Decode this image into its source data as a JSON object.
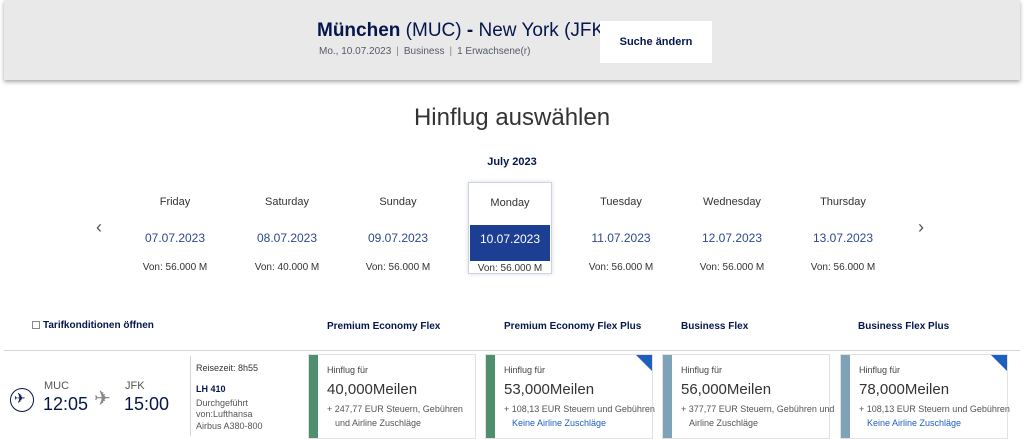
{
  "header": {
    "origin_city": "München",
    "origin_code": "(MUC)",
    "dash": "-",
    "dest_city": "New York",
    "dest_code": "(JFK)",
    "date": "Mo., 10.07.2023",
    "cabin": "Business",
    "pax": "1 Erwachsene(r)",
    "sep": "|",
    "change_label": "Suche ändern"
  },
  "title": "Hinflug auswählen",
  "month": "July 2023",
  "nav": {
    "prev_icon": "chevron-left-icon",
    "next_icon": "chevron-right-icon",
    "prev": "‹",
    "next": "›"
  },
  "days": [
    {
      "weekday": "Friday",
      "date": "07.07.2023",
      "price": "Von: 56.000 M",
      "selected": false
    },
    {
      "weekday": "Saturday",
      "date": "08.07.2023",
      "price": "Von: 40.000 M",
      "selected": false
    },
    {
      "weekday": "Sunday",
      "date": "09.07.2023",
      "price": "Von: 56.000 M",
      "selected": false
    },
    {
      "weekday": "Monday",
      "date": "10.07.2023",
      "price": "Von: 56.000 M",
      "selected": true
    },
    {
      "weekday": "Tuesday",
      "date": "11.07.2023",
      "price": "Von: 56.000 M",
      "selected": false
    },
    {
      "weekday": "Wednesday",
      "date": "12.07.2023",
      "price": "Von: 56.000 M",
      "selected": false
    },
    {
      "weekday": "Thursday",
      "date": "13.07.2023",
      "price": "Von: 56.000 M",
      "selected": false
    }
  ],
  "fare_table": {
    "tarif_link": "Tarifkonditionen öffnen",
    "headers": [
      "Premium Economy Flex",
      "Premium Economy Flex Plus",
      "Business Flex",
      "Business Flex Plus"
    ]
  },
  "flight": {
    "from_code": "MUC",
    "from_time": "12:05",
    "to_code": "JFK",
    "to_time": "15:00",
    "duration": "Reisezeit: 8h55",
    "flight_no": "LH 410",
    "operated1": "Durchgeführt",
    "operated2": "von:Lufthansa",
    "aircraft": "Airbus A380-800"
  },
  "fares": [
    {
      "label": "Hinflug für",
      "miles": "40,000Meilen",
      "tax1": "+ 247,77 EUR Steuern, Gebühren",
      "tax2": "und Airline Zuschläge",
      "bar_color": "#4e8f6e",
      "badge": false,
      "tax2_link": false
    },
    {
      "label": "Hinflug für",
      "miles": "53,000Meilen",
      "tax1": "+ 108,13 EUR Steuern und Gebühren",
      "tax2": "Keine Airline Zuschläge",
      "bar_color": "#4e8f6e",
      "badge": true,
      "tax2_link": true
    },
    {
      "label": "Hinflug für",
      "miles": "56,000Meilen",
      "tax1": "+ 377,77 EUR Steuern, Gebühren und",
      "tax2": "Airline Zuschläge",
      "bar_color": "#7ea3b8",
      "badge": false,
      "tax2_link": false
    },
    {
      "label": "Hinflug für",
      "miles": "78,000Meilen",
      "tax1": "+ 108,13 EUR Steuern und Gebühren",
      "tax2": "Keine Airline Zuschläge",
      "bar_color": "#7ea3b8",
      "badge": true,
      "tax2_link": true
    }
  ]
}
